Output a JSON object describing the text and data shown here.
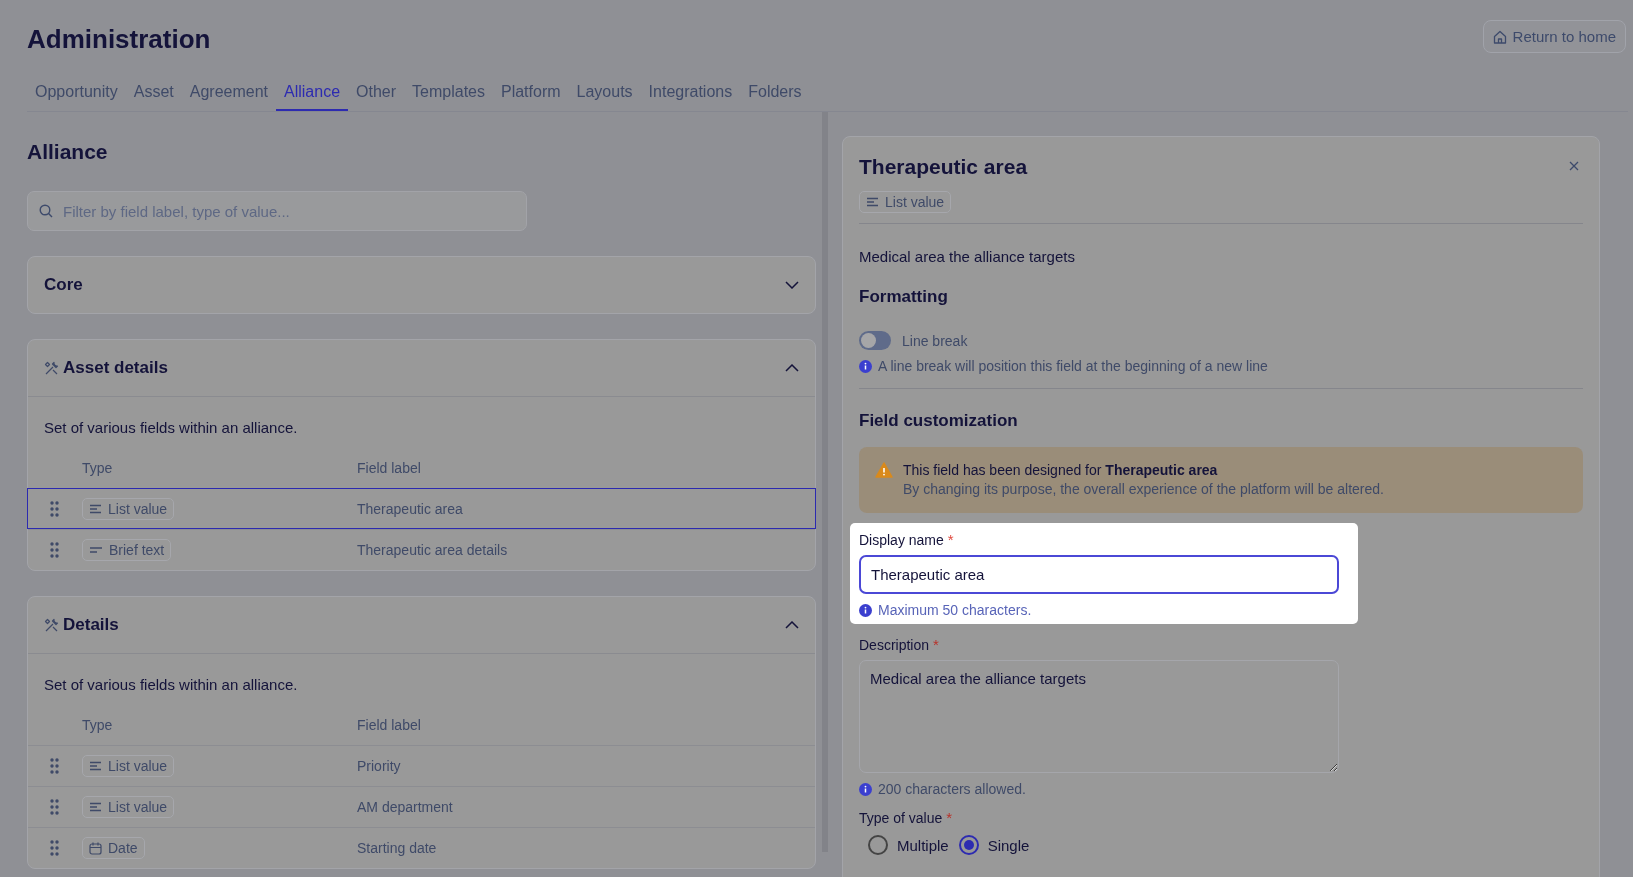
{
  "header": {
    "title": "Administration",
    "return_button": "Return to home"
  },
  "tabs": [
    {
      "label": "Opportunity",
      "selected": false
    },
    {
      "label": "Asset",
      "selected": false
    },
    {
      "label": "Agreement",
      "selected": false
    },
    {
      "label": "Alliance",
      "selected": true
    },
    {
      "label": "Other",
      "selected": false
    },
    {
      "label": "Templates",
      "selected": false
    },
    {
      "label": "Platform",
      "selected": false
    },
    {
      "label": "Layouts",
      "selected": false
    },
    {
      "label": "Integrations",
      "selected": false
    },
    {
      "label": "Folders",
      "selected": false
    }
  ],
  "section": {
    "title": "Alliance",
    "search": {
      "placeholder": "Filter by field label, type of value..."
    },
    "groups": [
      {
        "title": "Core",
        "icon": false,
        "expanded": false
      },
      {
        "title": "Asset details",
        "icon": true,
        "expanded": true,
        "description": "Set of various fields within an alliance.",
        "columns": [
          "Type",
          "Field label"
        ],
        "rows": [
          {
            "type": {
              "kind": "list",
              "label": "List value"
            },
            "field_label": "Therapeutic area",
            "selected": true
          },
          {
            "type": {
              "kind": "text",
              "label": "Brief text"
            },
            "field_label": "Therapeutic area details",
            "selected": false
          }
        ]
      },
      {
        "title": "Details",
        "icon": true,
        "expanded": true,
        "description": "Set of various fields within an alliance.",
        "columns": [
          "Type",
          "Field label"
        ],
        "rows": [
          {
            "type": {
              "kind": "list",
              "label": "List value"
            },
            "field_label": "Priority",
            "selected": false
          },
          {
            "type": {
              "kind": "list",
              "label": "List value"
            },
            "field_label": "AM department",
            "selected": false
          },
          {
            "type": {
              "kind": "date",
              "label": "Date"
            },
            "field_label": "Starting date",
            "selected": false
          }
        ]
      }
    ]
  },
  "detail_panel": {
    "title": "Therapeutic area",
    "type_chip": {
      "kind": "list",
      "label": "List value"
    },
    "description": "Medical area the alliance targets",
    "formatting": {
      "heading": "Formatting",
      "line_break": {
        "label": "Line break",
        "on": false
      },
      "hint": "A line break will position this field at the beginning of a new line"
    },
    "customization": {
      "heading": "Field customization",
      "warning": {
        "text": "This field has been designed for **Therapeutic area**",
        "subtext": "By changing its purpose, the overall experience of the platform will be altered."
      },
      "display_name": {
        "label": "Display name",
        "required_mark": "*",
        "value": "Therapeutic area",
        "hint": "Maximum 50 characters.",
        "highlighted": true
      },
      "description_field": {
        "label": "Description",
        "required_mark": "*",
        "value": "Medical area the alliance targets",
        "hint": "200 characters allowed."
      },
      "type_of_value": {
        "label": "Type of value",
        "required_mark": "*",
        "options": [
          {
            "label": "Multiple",
            "selected": false
          },
          {
            "label": "Single",
            "selected": true
          }
        ]
      }
    }
  }
}
